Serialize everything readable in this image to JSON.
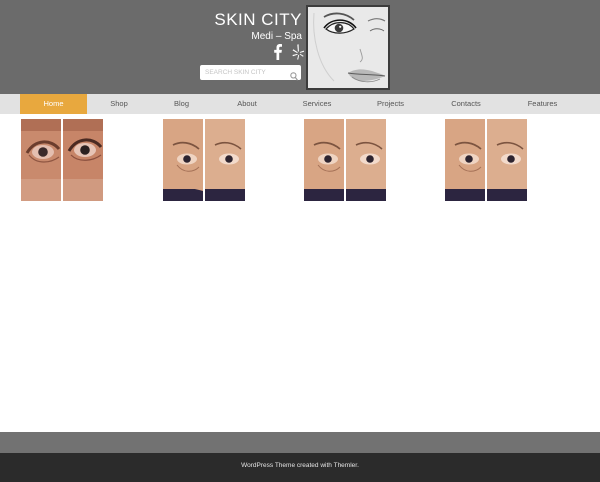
{
  "brand": {
    "title": "SKIN CITY",
    "subtitle": "Medi – Spa"
  },
  "social": {
    "facebook_icon": "facebook-icon",
    "yelp_icon": "yelp-icon"
  },
  "search": {
    "placeholder": "SEARCH SKIN CITY",
    "icon": "search-icon"
  },
  "portrait": {
    "icon": "face-sketch-image"
  },
  "nav": {
    "items": [
      {
        "label": "Home",
        "active": true
      },
      {
        "label": "Shop",
        "active": false
      },
      {
        "label": "Blog",
        "active": false
      },
      {
        "label": "About",
        "active": false
      },
      {
        "label": "Services",
        "active": false
      },
      {
        "label": "Projects",
        "active": false
      },
      {
        "label": "Contacts",
        "active": false
      },
      {
        "label": "Features",
        "active": false
      }
    ]
  },
  "gallery": {
    "items": [
      {
        "image": "before-after-eye-photo"
      },
      {
        "image": "before-after-eye-photo"
      },
      {
        "image": "before-after-eye-photo"
      },
      {
        "image": "before-after-eye-photo"
      }
    ]
  },
  "footer": {
    "text": "WordPress Theme created with Themler."
  },
  "colors": {
    "header_bg": "#6b6b6b",
    "nav_bg": "#e2e2e2",
    "nav_active": "#e8a83e",
    "footer_band": "#727272",
    "footer_bg": "#2b2b2b"
  }
}
